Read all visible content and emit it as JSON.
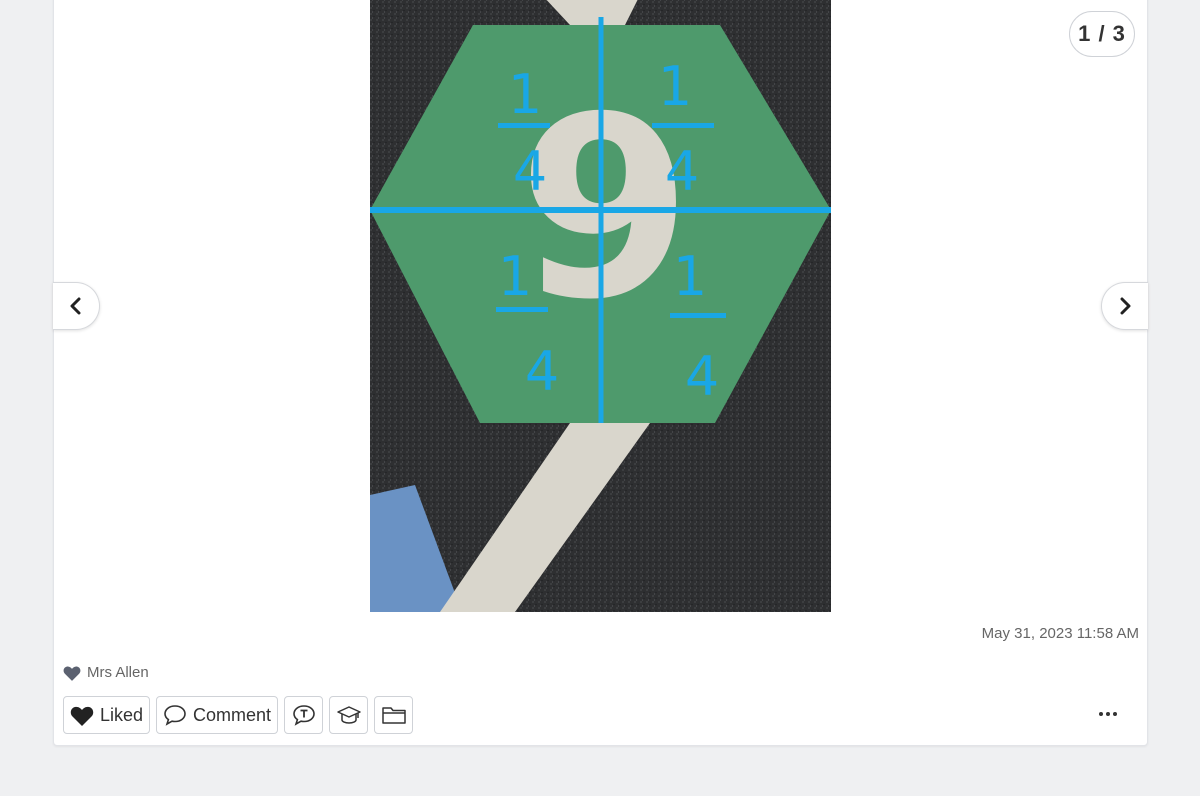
{
  "post": {
    "page_counter": "1 / 3",
    "timestamp": "May 31, 2023 11:58 AM",
    "liked_by": "Mrs Allen",
    "photo": {
      "number": "9",
      "fraction_numerator": "1",
      "fraction_denominator": "4",
      "colors": {
        "hexagon": "#4e9a6c",
        "asphalt": "#2e2f31",
        "line": "#19a7e6",
        "stripe": "#d9d6cc",
        "corner": "#6a92c4"
      }
    }
  },
  "actions": {
    "liked_label": "Liked",
    "comment_label": "Comment"
  },
  "icons": {
    "prev": "chevron-left-icon",
    "next": "chevron-right-icon",
    "liked": "heart-icon",
    "comment": "speech-bubble-icon",
    "translate": "translate-bubble-icon",
    "skills": "graduation-cap-icon",
    "folder": "folder-icon",
    "more": "more-dots-icon"
  }
}
